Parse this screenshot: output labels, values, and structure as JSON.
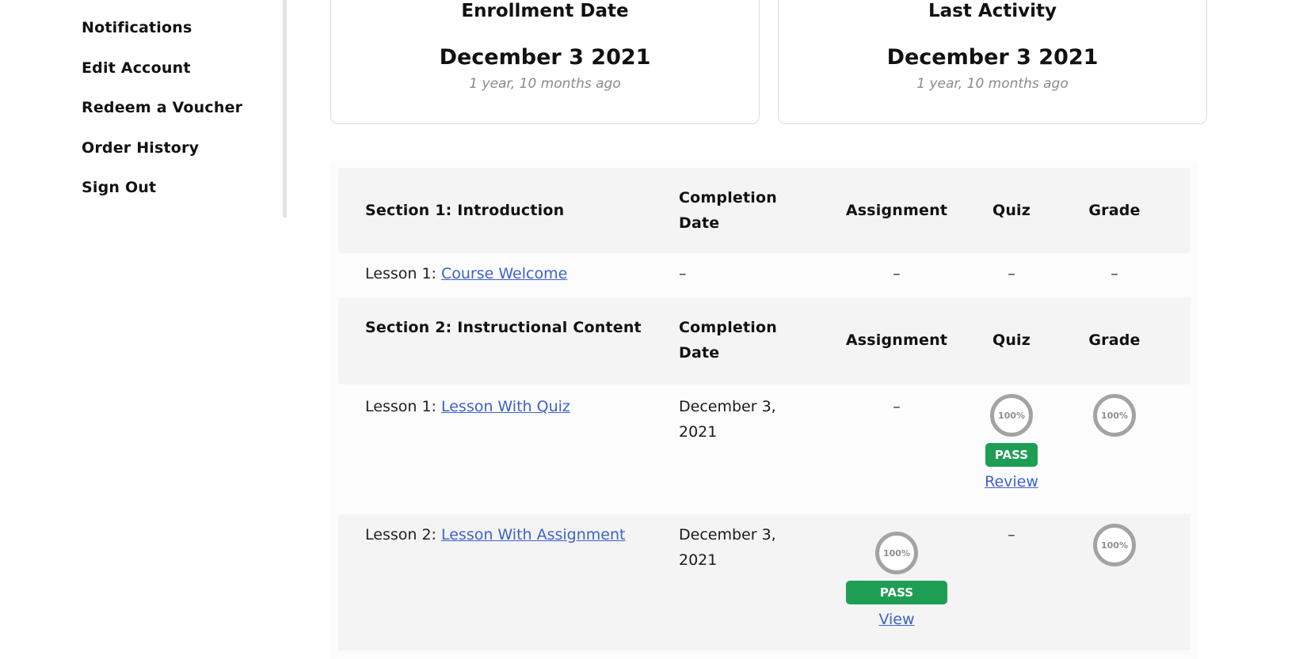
{
  "sidebar": {
    "items": [
      {
        "label": "Notifications"
      },
      {
        "label": "Edit Account"
      },
      {
        "label": "Redeem a Voucher"
      },
      {
        "label": "Order History"
      },
      {
        "label": "Sign Out"
      }
    ]
  },
  "cards": {
    "enrollment": {
      "title": "Enrollment Date",
      "date": "December 3 2021",
      "ago": "1 year, 10 months ago"
    },
    "activity": {
      "title": "Last Activity",
      "date": "December 3 2021",
      "ago": "1 year, 10 months ago"
    }
  },
  "table": {
    "columns": {
      "completion": "Completion Date",
      "assignment": "Assignment",
      "quiz": "Quiz",
      "grade": "Grade"
    },
    "sections": [
      {
        "title": "Section 1: Introduction",
        "lessons": [
          {
            "prefix": "Lesson 1: ",
            "name": "Course Welcome",
            "completion": "–",
            "assignment": "–",
            "quiz": "–",
            "grade": "–"
          }
        ]
      },
      {
        "title": "Section 2: Instructional Content",
        "lessons": [
          {
            "prefix": "Lesson 1: ",
            "name": "Lesson With Quiz",
            "completion": "December 3, 2021",
            "assignment": "–",
            "quiz_score": "100%",
            "quiz_status": "PASS",
            "quiz_link": "Review",
            "grade": "100%"
          },
          {
            "prefix": "Lesson 2: ",
            "name": "Lesson With Assignment",
            "completion": "December 3, 2021",
            "assignment_score": "100%",
            "assignment_status": "PASS",
            "assignment_link": "View",
            "quiz": "–",
            "grade": "100%"
          }
        ]
      }
    ]
  },
  "colors": {
    "pass": "#1e9e55",
    "link": "#3d63c9",
    "ring": "#a3a3a3"
  }
}
